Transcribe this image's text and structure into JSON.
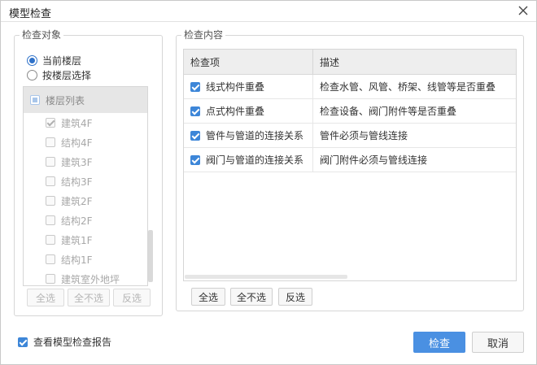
{
  "window": {
    "title": "模型检查"
  },
  "left_panel": {
    "legend": "检查对象",
    "radio_options": [
      {
        "label": "当前楼层",
        "selected": true
      },
      {
        "label": "按楼层选择",
        "selected": false
      }
    ],
    "floor_list": {
      "header": "楼层列表",
      "items": [
        {
          "label": "建筑4F",
          "checked": true
        },
        {
          "label": "结构4F",
          "checked": false
        },
        {
          "label": "建筑3F",
          "checked": false
        },
        {
          "label": "结构3F",
          "checked": false
        },
        {
          "label": "建筑2F",
          "checked": false
        },
        {
          "label": "结构2F",
          "checked": false
        },
        {
          "label": "建筑1F",
          "checked": false
        },
        {
          "label": "结构1F",
          "checked": false
        },
        {
          "label": "建筑室外地坪",
          "checked": false
        }
      ]
    },
    "buttons": {
      "select_all": "全选",
      "select_none": "全不选",
      "invert": "反选"
    }
  },
  "right_panel": {
    "legend": "检查内容",
    "table": {
      "columns": [
        "检查项",
        "描述"
      ],
      "rows": [
        {
          "item": "线式构件重叠",
          "desc": "检查水管、风管、桥架、线管等是否重叠",
          "checked": true
        },
        {
          "item": "点式构件重叠",
          "desc": "检查设备、阀门附件等是否重叠",
          "checked": true
        },
        {
          "item": "管件与管道的连接关系",
          "desc": "管件必须与管线连接",
          "checked": true
        },
        {
          "item": "阀门与管道的连接关系",
          "desc": "阀门附件必须与管线连接",
          "checked": true
        }
      ]
    },
    "buttons": {
      "select_all": "全选",
      "select_none": "全不选",
      "invert": "反选"
    }
  },
  "footer": {
    "report_label": "查看模型检查报告",
    "report_checked": true,
    "check_button": "检查",
    "cancel_button": "取消"
  },
  "colors": {
    "accent": "#4a90e2",
    "checkbox_on": "#3d86d8",
    "radio_on": "#2f72c9"
  }
}
